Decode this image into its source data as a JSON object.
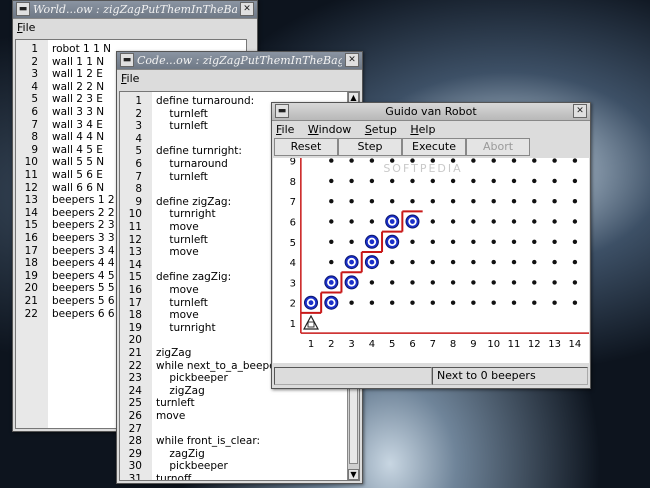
{
  "world_window": {
    "title": "World...ow : zigZagPutThemInTheBag.wld",
    "menu": [
      "File"
    ],
    "lines": [
      "robot 1 1 N",
      "wall 1 1 N",
      "wall 1 2 E",
      "wall 2 2 N",
      "wall 2 3 E",
      "wall 3 3 N",
      "wall 3 4 E",
      "wall 4 4 N",
      "wall 4 5 E",
      "wall 5 5 N",
      "wall 5 6 E",
      "wall 6 6 N",
      "beepers 1 2 1",
      "beepers 2 2 1",
      "beepers 2 3 1",
      "beepers 3 3 1",
      "beepers 3 4 1",
      "beepers 4 4 1",
      "beepers 4 5 1",
      "beepers 5 5 1",
      "beepers 5 6 1",
      "beepers 6 6 1"
    ]
  },
  "code_window": {
    "title": "Code...ow : zigZagPutThemInTheBag.gvr",
    "menu": [
      "File"
    ],
    "lines": [
      "define turnaround:",
      "    turnleft",
      "    turnleft",
      "",
      "define turnright:",
      "    turnaround",
      "    turnleft",
      "",
      "define zigZag:",
      "    turnright",
      "    move",
      "    turnleft",
      "    move",
      "",
      "define zagZig:",
      "    move",
      "    turnleft",
      "    move",
      "    turnright",
      "",
      "zigZag",
      "while next_to_a_beeper:",
      "    pickbeeper",
      "    zigZag",
      "turnleft",
      "move",
      "",
      "while front_is_clear:",
      "    zagZig",
      "    pickbeeper",
      "turnoff"
    ]
  },
  "robot_window": {
    "title": "Guido van Robot",
    "menu": [
      "File",
      "Window",
      "Setup",
      "Help"
    ],
    "buttons": {
      "reset": "Reset",
      "step": "Step",
      "execute": "Execute",
      "abort": "Abort"
    },
    "status_left": "",
    "status_right": "Next to 0 beepers",
    "watermark": "SOFTPEDIA"
  },
  "world": {
    "x_labels": [
      "1",
      "2",
      "3",
      "4",
      "5",
      "6",
      "7",
      "8",
      "9",
      "10",
      "11",
      "12",
      "13",
      "14"
    ],
    "y_labels": [
      "1",
      "2",
      "3",
      "4",
      "5",
      "6",
      "7",
      "8",
      "9"
    ],
    "robot": {
      "avenue": 1,
      "street": 1,
      "facing": "N"
    },
    "beepers": [
      [
        1,
        2
      ],
      [
        2,
        2
      ],
      [
        2,
        3
      ],
      [
        3,
        3
      ],
      [
        3,
        4
      ],
      [
        4,
        4
      ],
      [
        4,
        5
      ],
      [
        5,
        5
      ],
      [
        5,
        6
      ],
      [
        6,
        6
      ]
    ],
    "walls": [
      [
        1,
        1,
        "N"
      ],
      [
        1,
        2,
        "E"
      ],
      [
        2,
        2,
        "N"
      ],
      [
        2,
        3,
        "E"
      ],
      [
        3,
        3,
        "N"
      ],
      [
        3,
        4,
        "E"
      ],
      [
        4,
        4,
        "N"
      ],
      [
        4,
        5,
        "E"
      ],
      [
        5,
        5,
        "N"
      ],
      [
        5,
        6,
        "E"
      ],
      [
        6,
        6,
        "N"
      ]
    ],
    "wall_color": "#c81818",
    "beeper_color": "#1a2fc8"
  }
}
